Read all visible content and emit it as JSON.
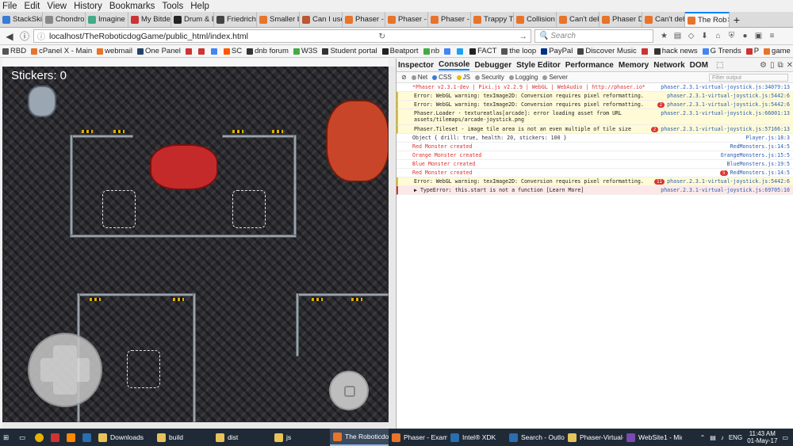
{
  "menu": [
    "File",
    "Edit",
    "View",
    "History",
    "Bookmarks",
    "Tools",
    "Help"
  ],
  "tabs": [
    {
      "label": "StackSkills",
      "color": "#3a7bd5"
    },
    {
      "label": "Chondro",
      "color": "#888"
    },
    {
      "label": "Imagine P",
      "color": "#4a8"
    },
    {
      "label": "My Bitdefen",
      "color": "#c33"
    },
    {
      "label": "Drum & B",
      "color": "#222"
    },
    {
      "label": "Friedrich",
      "color": "#444"
    },
    {
      "label": "Smaller b",
      "color": "#e8732a"
    },
    {
      "label": "Can I use",
      "color": "#b53"
    },
    {
      "label": "Phaser - I",
      "color": "#e8732a"
    },
    {
      "label": "Phaser - I",
      "color": "#e8732a"
    },
    {
      "label": "Phaser - I",
      "color": "#e8732a"
    },
    {
      "label": "Trappy Tr",
      "color": "#e8732a"
    },
    {
      "label": "Collision",
      "color": "#e8732a"
    },
    {
      "label": "Can't deb",
      "color": "#e8732a"
    },
    {
      "label": "Phaser Dd",
      "color": "#e8732a"
    },
    {
      "label": "Can't deb",
      "color": "#e8732a"
    },
    {
      "label": "The Rob",
      "color": "#e8732a",
      "active": true
    }
  ],
  "url": "localhost/TheRoboticdogGame/public_html/index.html",
  "search_placeholder": "Search",
  "bookmarks": [
    {
      "label": "RBD",
      "color": "#555"
    },
    {
      "label": "cPanel X - Main",
      "color": "#e8732a"
    },
    {
      "label": "webmail",
      "color": "#e8732a"
    },
    {
      "label": "One Panel",
      "color": "#246"
    },
    {
      "label": "",
      "color": "#c33"
    },
    {
      "label": "",
      "color": "#c33"
    },
    {
      "label": "",
      "color": "#4285f4"
    },
    {
      "label": "SC",
      "color": "#f50"
    },
    {
      "label": "dnb forum",
      "color": "#333"
    },
    {
      "label": "W3S",
      "color": "#4a4"
    },
    {
      "label": "Student portal",
      "color": "#333"
    },
    {
      "label": "Beatport",
      "color": "#222"
    },
    {
      "label": "nb",
      "color": "#4a4"
    },
    {
      "label": "",
      "color": "#4285f4"
    },
    {
      "label": "",
      "color": "#1da1f2"
    },
    {
      "label": "FACT",
      "color": "#222"
    },
    {
      "label": "the loop",
      "color": "#555"
    },
    {
      "label": "PayPal",
      "color": "#003087"
    },
    {
      "label": "Discover Music",
      "color": "#444"
    },
    {
      "label": "",
      "color": "#c33"
    },
    {
      "label": "hack news",
      "color": "#333"
    },
    {
      "label": "G Trends",
      "color": "#4285f4"
    },
    {
      "label": "P",
      "color": "#c33"
    },
    {
      "label": "game",
      "color": "#e8732a"
    }
  ],
  "game": {
    "stickers_label": "Stickers: 0"
  },
  "devtools": {
    "tabs": [
      "Inspector",
      "Console",
      "Debugger",
      "Style Editor",
      "Performance",
      "Memory",
      "Network",
      "DOM"
    ],
    "filters": [
      {
        "label": "Net",
        "color": "#999"
      },
      {
        "label": "CSS",
        "color": "#3a7bd5"
      },
      {
        "label": "JS",
        "color": "#e8c000"
      },
      {
        "label": "Security",
        "color": "#999"
      },
      {
        "label": "Logging",
        "color": "#999"
      },
      {
        "label": "Server",
        "color": "#999"
      }
    ],
    "filter_placeholder": "Filter output",
    "logs": [
      {
        "kind": "red",
        "msg": "*Phaser v2.3.1-dev | Pixi.js v2.2.9 | WebGL | WebAudio | http://phaser.io*",
        "src": "phaser.2.3.1-virtual-joystick.js:34079:13"
      },
      {
        "kind": "warn",
        "msg": "Error: WebGL warning: texImage2D: Conversion requires pixel reformatting.",
        "src": "phaser.2.3.1-virtual-joystick.js:5442:6"
      },
      {
        "kind": "warn",
        "msg": "Error: WebGL warning: texImage2D: Conversion requires pixel reformatting.",
        "src": "phaser.2.3.1-virtual-joystick.js:5442:6",
        "count": "2"
      },
      {
        "kind": "warn wrap",
        "msg": "Phaser.Loader - textureatlas[arcade]: error loading asset from URL assets/tilemaps/arcade-joystick.png",
        "src": "phaser.2.3.1-virtual-joystick.js:66001:13"
      },
      {
        "kind": "warn",
        "msg": "Phaser.Tileset - image tile area is not an even multiple of tile size",
        "src": "phaser.2.3.1-virtual-joystick.js:57166:13",
        "count": "2"
      },
      {
        "kind": "info",
        "msg": "Object { drill: true, health: 20, stickers: 100 }",
        "src": "Player.js:18:3"
      },
      {
        "kind": "red",
        "msg": "Red Monster created",
        "src": "RedMonsters.js:14:5"
      },
      {
        "kind": "red",
        "msg": "Orange Monster created",
        "src": "OrangeMonsters.js:15:5"
      },
      {
        "kind": "red",
        "msg": "Blue Monster created",
        "src": "BlueMonsters.js:19:5"
      },
      {
        "kind": "red",
        "msg": "Red Monster created",
        "src": "RedMonsters.js:14:5",
        "count": "5"
      },
      {
        "kind": "warn",
        "msg": "Error: WebGL warning: texImage2D: Conversion requires pixel reformatting.",
        "src": "phaser.2.3.1-virtual-joystick.js:5442:6",
        "count": "11"
      },
      {
        "kind": "error",
        "msg": "▶ TypeError: this.start is not a function [Learn More]",
        "src": "phaser.2.3.1-virtual-joystick.js:69705:10"
      }
    ]
  },
  "taskbar": {
    "items": [
      {
        "label": "Downloads",
        "color": "#e8c35a"
      },
      {
        "label": "build",
        "color": "#e8c35a"
      },
      {
        "label": "dist",
        "color": "#e8c35a"
      },
      {
        "label": "js",
        "color": "#e8c35a"
      },
      {
        "label": "The Roboticdog...",
        "color": "#e8732a",
        "active": true
      },
      {
        "label": "Phaser - Exampl...",
        "color": "#e8732a"
      },
      {
        "label": "Intel® XDK",
        "color": "#2a6db0"
      },
      {
        "label": "Search - Outloo...",
        "color": "#2a6db0"
      },
      {
        "label": "Phaser-Virtual-J...",
        "color": "#e8c35a"
      },
      {
        "label": "WebSite1 - Micr...",
        "color": "#7a4ab0"
      }
    ],
    "lang": "ENG",
    "time": "11:43 AM",
    "date": "01-May-17"
  }
}
